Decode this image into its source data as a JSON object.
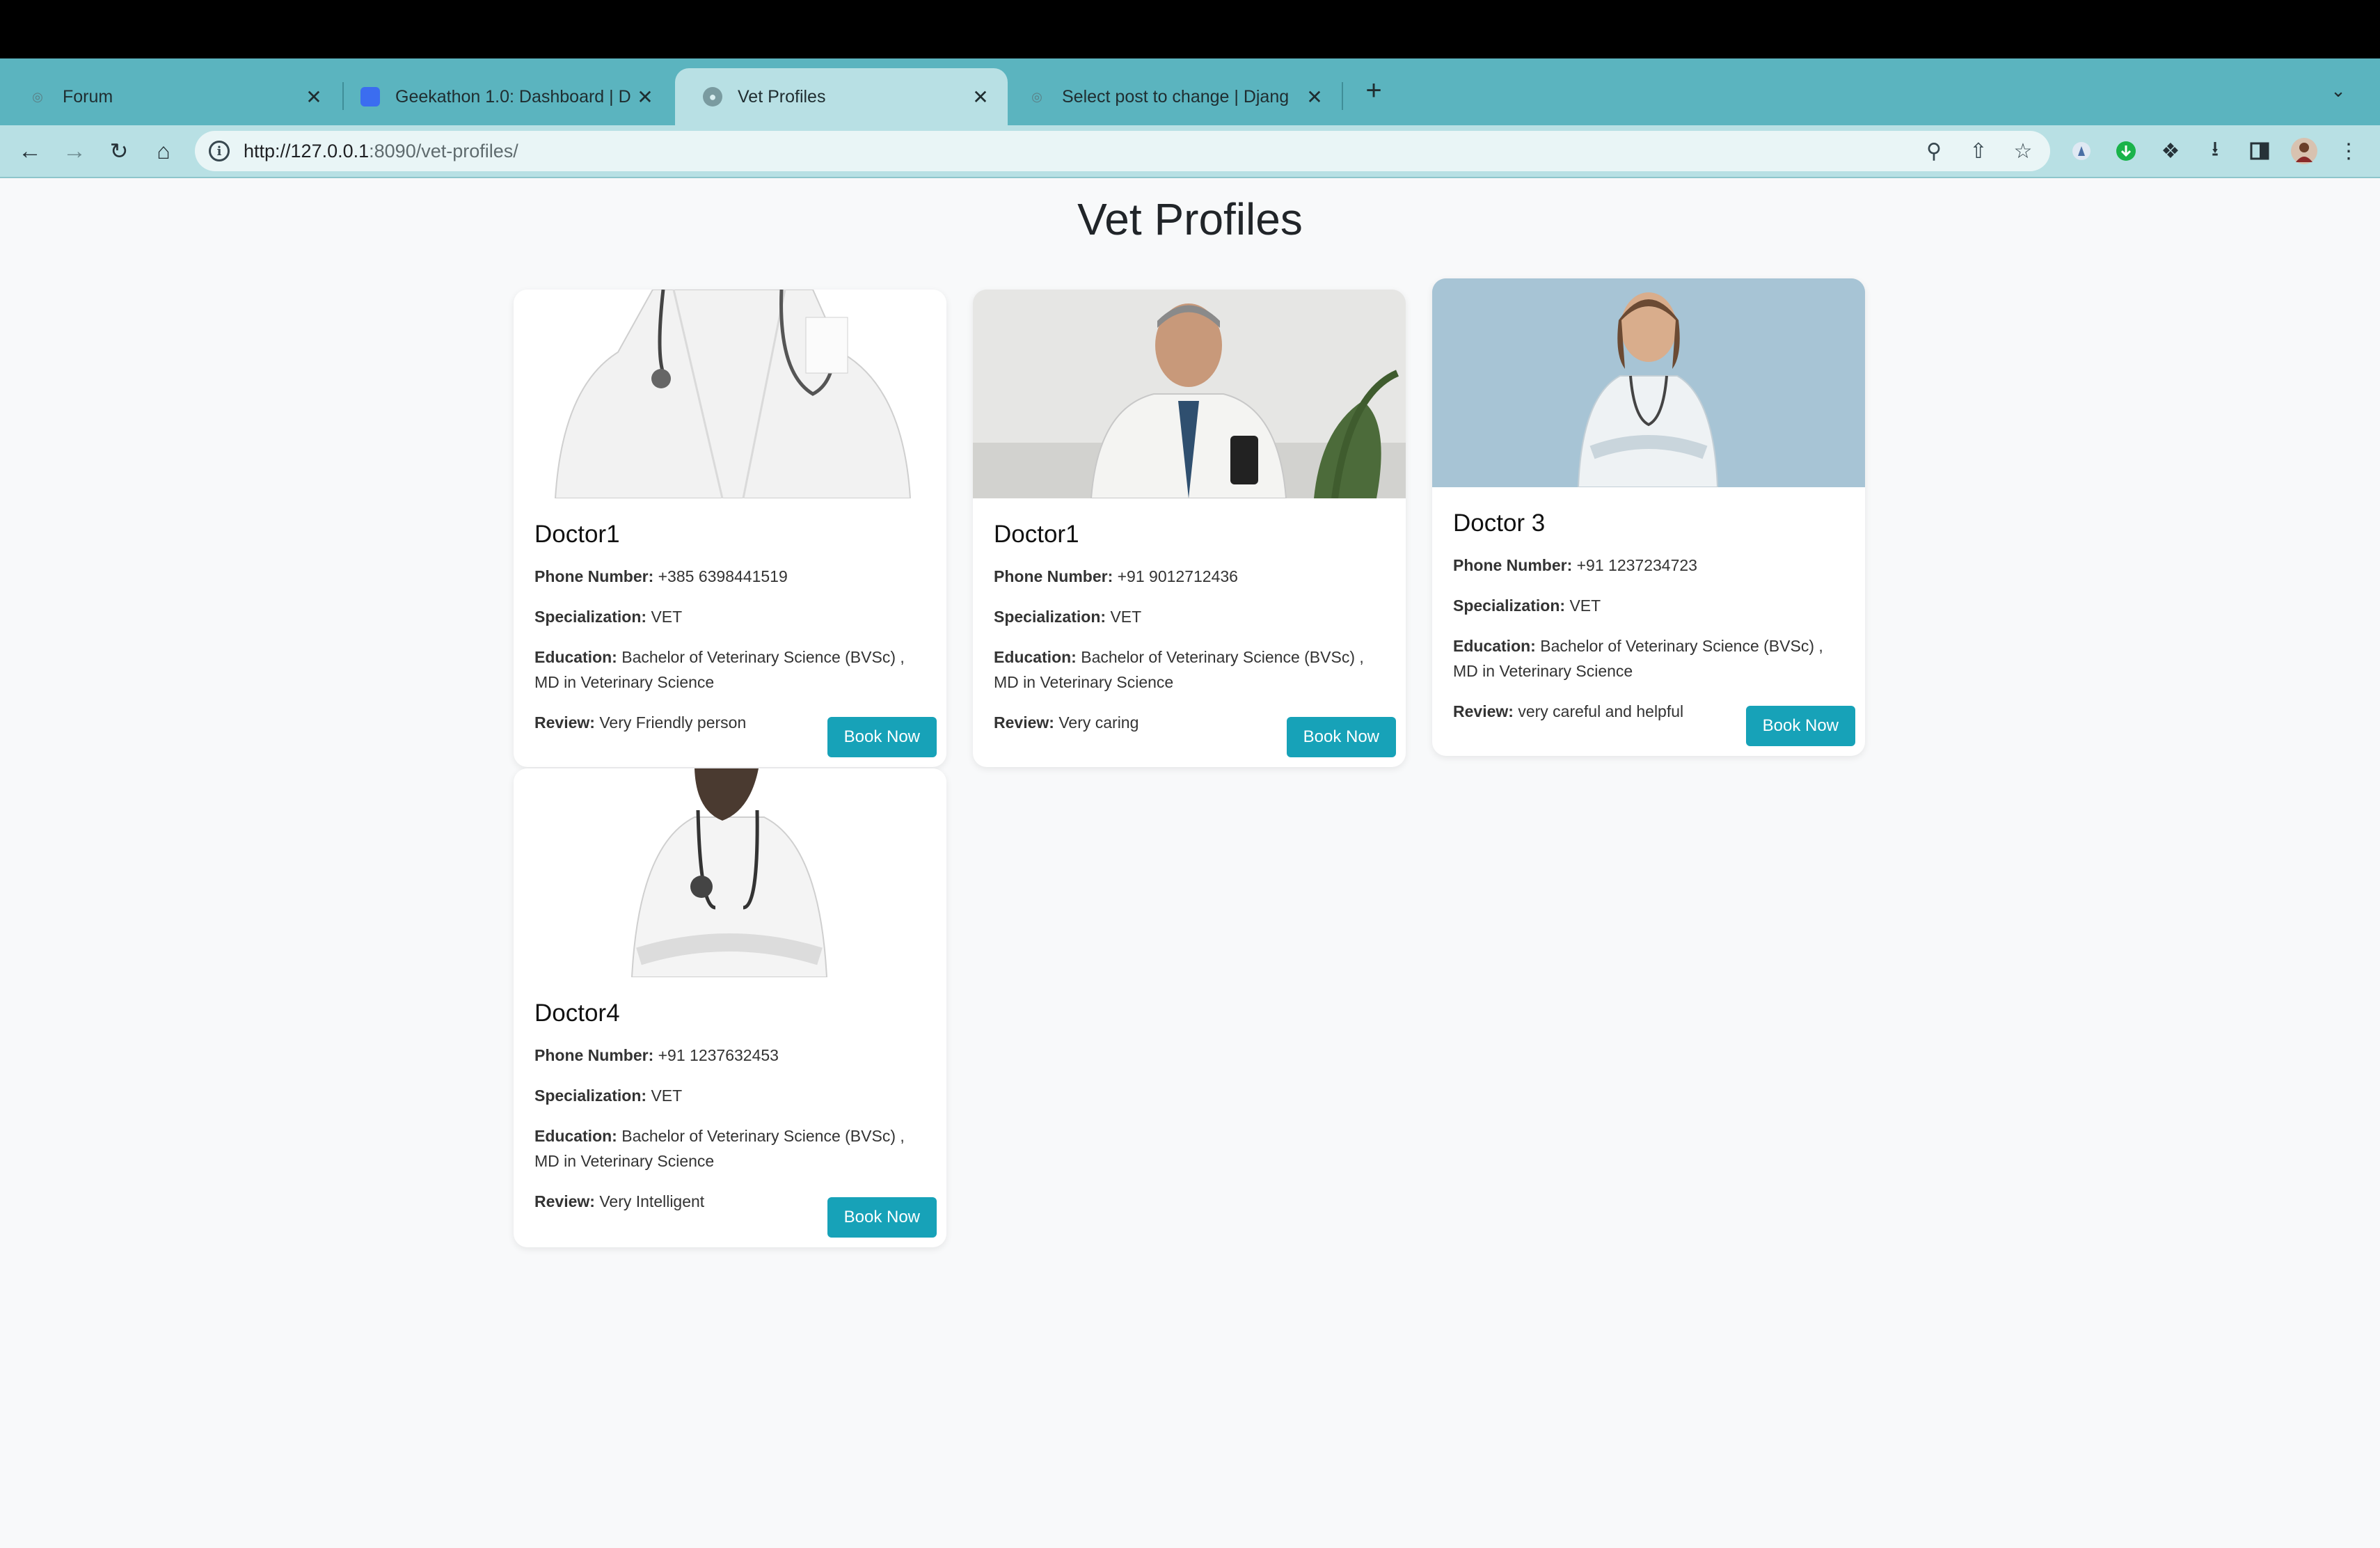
{
  "browser": {
    "tabs": [
      {
        "title": "Forum",
        "active": false,
        "icon": "forum-favicon"
      },
      {
        "title": "Geekathon 1.0: Dashboard | D",
        "active": false,
        "icon": "dashboard-favicon"
      },
      {
        "title": "Vet Profiles",
        "active": true,
        "icon": "globe-favicon"
      },
      {
        "title": "Select post to change | Djang",
        "active": false,
        "icon": "django-favicon"
      }
    ],
    "url": {
      "host": "http://127.0.0.1",
      "path": ":8090/vet-profiles/"
    }
  },
  "page": {
    "title": "Vet Profiles",
    "labels": {
      "phone": "Phone Number:",
      "specialization": "Specialization:",
      "education": "Education:",
      "review": "Review:"
    },
    "book_label": "Book Now",
    "doctors": [
      {
        "name": "Doctor1",
        "phone": "+385 6398441519",
        "specialization": "VET",
        "education": "Bachelor of Veterinary Science (BVSc) , MD in Veterinary Science",
        "review": "Very Friendly person"
      },
      {
        "name": "Doctor1",
        "phone": "+91 9012712436",
        "specialization": "VET",
        "education": "Bachelor of Veterinary Science (BVSc) , MD in Veterinary Science",
        "review": "Very caring"
      },
      {
        "name": "Doctor 3",
        "phone": "+91 1237234723",
        "specialization": "VET",
        "education": "Bachelor of Veterinary Science (BVSc) , MD in Veterinary Science",
        "review": "very careful and helpful"
      },
      {
        "name": "Doctor4",
        "phone": "+91 1237632453",
        "specialization": "VET",
        "education": "Bachelor of Veterinary Science (BVSc) , MD in Veterinary Science",
        "review": "Very Intelligent"
      }
    ]
  },
  "colors": {
    "tabstrip": "#5bb4bf",
    "toolbar": "#b8e0e4",
    "button": "#17a2b8",
    "page_bg": "#f8f9fa"
  }
}
